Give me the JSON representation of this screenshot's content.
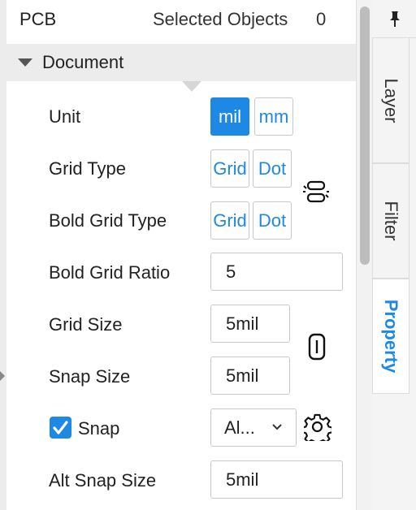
{
  "header": {
    "title": "PCB",
    "selected_label": "Selected Objects",
    "selected_count": "0"
  },
  "section": {
    "label": "Document",
    "expanded": true
  },
  "rows": {
    "unit": {
      "label": "Unit",
      "options": [
        "mil",
        "mm"
      ],
      "selected": "mil"
    },
    "grid_type": {
      "label": "Grid Type",
      "options": [
        "Grid",
        "Dot"
      ]
    },
    "bold_grid_type": {
      "label": "Bold Grid Type",
      "options": [
        "Grid",
        "Dot"
      ]
    },
    "bold_grid_ratio": {
      "label": "Bold Grid Ratio",
      "value": "5"
    },
    "grid_size": {
      "label": "Grid Size",
      "value": "5mil"
    },
    "snap_size": {
      "label": "Snap Size",
      "value": "5mil"
    },
    "snap": {
      "label": "Snap",
      "checked": true,
      "mode": "Al..."
    },
    "alt_snap_size": {
      "label": "Alt Snap Size",
      "value": "5mil"
    }
  },
  "icons": {
    "unlink": "unlink-icon",
    "link": "link-icon",
    "settings": "gear-icon",
    "pin": "pin-icon"
  },
  "side_tabs": [
    "Layer",
    "Filter",
    "Property"
  ],
  "active_tab": "Property",
  "colors": {
    "accent": "#1e88e5",
    "section_bg": "#ececec"
  }
}
